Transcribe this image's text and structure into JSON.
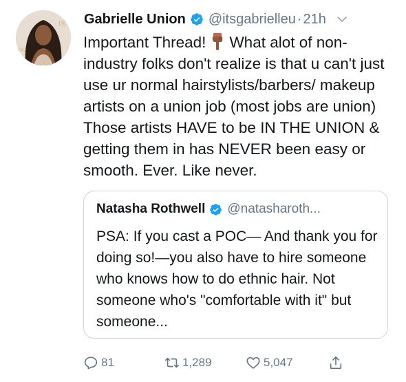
{
  "tweet": {
    "author_name": "Gabrielle Union",
    "author_handle": "@itsgabrielleu",
    "separator": "·",
    "time": "21h",
    "text_part1": "Important Thread!",
    "text_part2": "What alot of non-industry folks don't realize is that u can't just use ur normal hairstylists/barbers/ makeup artists on a union job (most jobs are union) Those artists HAVE to be IN THE UNION & getting them in has NEVER been easy or smooth. Ever. Like never."
  },
  "quoted_tweet": {
    "author_name": "Natasha Rothwell",
    "author_handle": "@natasharoth...",
    "text": "PSA: If you cast a POC— And thank you for doing so!—you also have to hire someone who knows how to do ethnic hair. Not someone who's \"comfortable with it\" but someone..."
  },
  "actions": {
    "replies": "81",
    "retweets": "1,289",
    "likes": "5,047"
  },
  "icons": {
    "verified": "verified-badge-icon",
    "caret": "chevron-down-icon",
    "emoji": "backhand-index-pointing-down-emoji",
    "reply": "reply-icon",
    "retweet": "retweet-icon",
    "like": "heart-icon",
    "share": "share-icon"
  },
  "colors": {
    "verified": "#1da1f2",
    "secondary_text": "#657786",
    "border": "#ccd6dd"
  }
}
